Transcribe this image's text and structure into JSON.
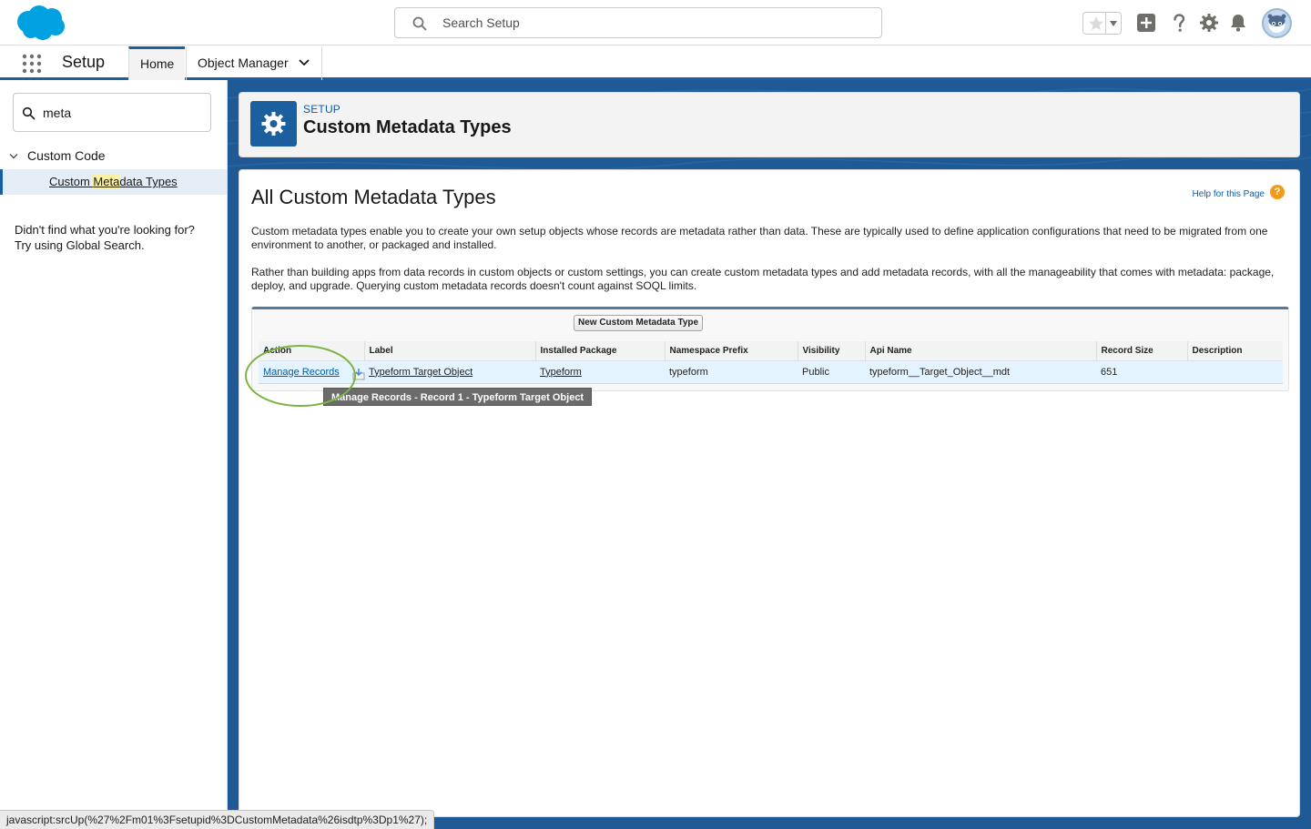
{
  "header": {
    "search_placeholder": "Search Setup"
  },
  "context_bar": {
    "app_name": "Setup",
    "tabs": [
      {
        "label": "Home"
      },
      {
        "label": "Object Manager"
      }
    ]
  },
  "sidebar": {
    "quick_find_value": "meta",
    "tree": {
      "parent_label": "Custom Code",
      "child_before": "Custom ",
      "child_highlight": "Meta",
      "child_after": "data Types"
    },
    "not_found_line1": "Didn't find what you're looking for?",
    "not_found_line2": "Try using Global Search."
  },
  "page_header": {
    "eyebrow": "SETUP",
    "title": "Custom Metadata Types"
  },
  "content": {
    "title": "All Custom Metadata Types",
    "help_link": "Help for this Page",
    "help_icon_glyph": "?",
    "description_1": "Custom metadata types enable you to create your own setup objects whose records are metadata rather than data. These are typically used to define application configurations that need to be migrated from one environment to another, or packaged and installed.",
    "description_2": "Rather than building apps from data records in custom objects or custom settings, you can create custom metadata types and add metadata records, with all the manageability that comes with metadata: package, deploy, and upgrade. Querying custom metadata records doesn't count against SOQL limits.",
    "new_button": "New Custom Metadata Type",
    "table": {
      "columns": [
        "Action",
        "Label",
        "Installed Package",
        "Namespace Prefix",
        "Visibility",
        "Api Name",
        "Record Size",
        "Description"
      ],
      "rows": [
        {
          "action": "Manage Records",
          "label": "Typeform Target Object",
          "installed_package": "Typeform",
          "namespace_prefix": "typeform",
          "visibility": "Public",
          "api_name": "typeform__Target_Object__mdt",
          "record_size": "651",
          "description": ""
        }
      ]
    },
    "tooltip": "Manage Records - Record 1 - Typeform Target Object"
  },
  "status_bar": "javascript:srcUp(%27%2Fm01%3Fsetupid%3DCustomMetadata%26isdtp%3Dp1%27);",
  "colors": {
    "brand_blue": "#1b5f9e",
    "logo_blue": "#00a1e0",
    "link_blue": "#015ba7",
    "row_highlight": "#e3f3ff",
    "annotation_green": "#7cb342"
  }
}
